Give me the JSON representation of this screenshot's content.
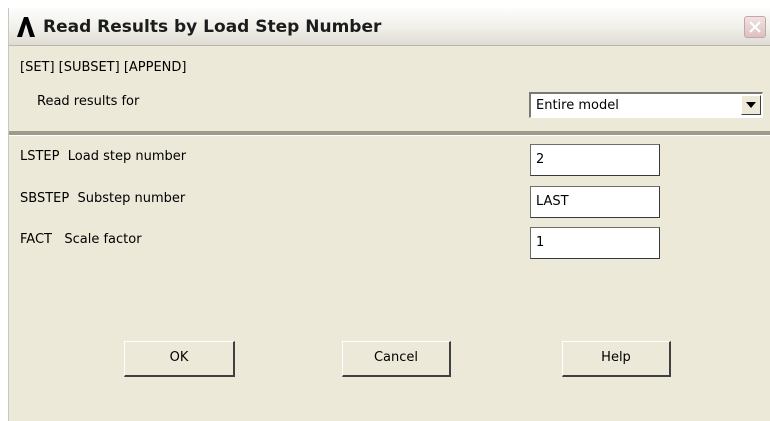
{
  "window": {
    "title": "Read Results by Load Step Number",
    "command_line": "[SET] [SUBSET] [APPEND]"
  },
  "read_results": {
    "label": "Read results for",
    "selected": "Entire model"
  },
  "fields": [
    {
      "name": "LSTEP",
      "label": "Load step number",
      "value": "2"
    },
    {
      "name": "SBSTEP",
      "label": "Substep number",
      "value": "LAST"
    },
    {
      "name": "FACT",
      "label": "Scale factor",
      "value": "1"
    }
  ],
  "buttons": {
    "ok": "OK",
    "cancel": "Cancel",
    "help": "Help"
  },
  "icons": {
    "app": "ansys-logo-icon",
    "close": "close-icon",
    "dropdown": "chevron-down-icon"
  },
  "colors": {
    "dialog_bg": "#ece9d8",
    "close_x": "#ffffff",
    "close_bg": "#d9b9b9"
  }
}
